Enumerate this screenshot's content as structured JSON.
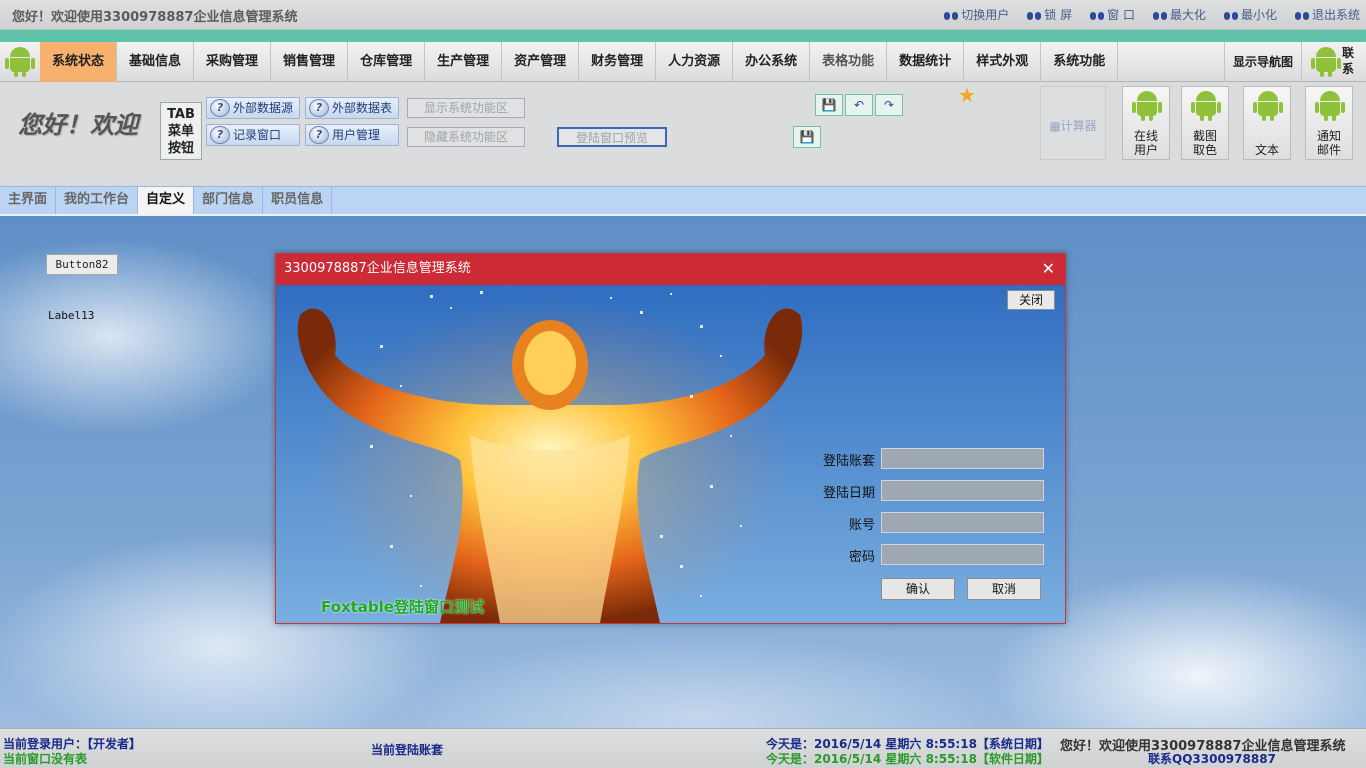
{
  "titlebar": {
    "title": "您好！欢迎使用3300978887企业信息管理系统",
    "buttons": [
      "切换用户",
      "锁 屏",
      "窗 口",
      "最大化",
      "最小化",
      "退出系统"
    ]
  },
  "menu": {
    "items": [
      "系统状态",
      "基础信息",
      "采购管理",
      "销售管理",
      "仓库管理",
      "生产管理",
      "资产管理",
      "财务管理",
      "人力资源",
      "办公系统",
      "表格功能",
      "数据统计",
      "样式外观",
      "系统功能"
    ],
    "active_index": 0,
    "nav_map": "显示导航图",
    "contact_1": "联",
    "contact_2": "系"
  },
  "toolbar": {
    "welcome": "您好！欢迎",
    "tab_line1": "TAB",
    "tab_line2": "菜单",
    "tab_line3": "按钮",
    "ext_source": "外部数据源",
    "ext_table": "外部数据表",
    "log_window": "记录窗口",
    "user_mgmt": "用户管理",
    "show_func": "显示系统功能区",
    "hide_func": "隐藏系统功能区",
    "login_preview": "登陆窗口预览",
    "calculator": "计算器",
    "tiles": [
      {
        "line1": "在线",
        "line2": "用户"
      },
      {
        "line1": "截图",
        "line2": "取色"
      },
      {
        "line1": "文本",
        "line2": ""
      },
      {
        "line1": "通知",
        "line2": "邮件"
      }
    ]
  },
  "tabs": [
    "主界面",
    "我的工作台",
    "自定义",
    "部门信息",
    "职员信息"
  ],
  "active_tab": 2,
  "workspace": {
    "button82": "Button82",
    "label13": "Label13"
  },
  "dialog": {
    "title": "3300978887企业信息管理系统",
    "close_button": "关闭",
    "fields": [
      {
        "label": "登陆账套",
        "value": ""
      },
      {
        "label": "登陆日期",
        "value": ""
      },
      {
        "label": "账号",
        "value": ""
      },
      {
        "label": "密码",
        "value": ""
      }
    ],
    "confirm": "确认",
    "cancel": "取消",
    "caption": "Foxtable登陆窗口测试"
  },
  "statusbar": {
    "current_user": "当前登录用户：【开发者】",
    "no_window": "当前窗口没有表",
    "current_account": "当前登陆账套",
    "today_system": "今天是：2016/5/14 星期六 8:55:18【系统日期】",
    "today_software": "今天是：2016/5/14 星期六 8:55:18【软件日期】",
    "welcome": "您好！欢迎使用3300978887企业信息管理系统",
    "contact_qq": "联系QQ3300978887"
  },
  "colors": {
    "active_menu": "#f7b16e",
    "dialog_title": "#cc2b36",
    "teal_stripe": "#5ec3a8",
    "tabs_bg": "#bcd4f4"
  }
}
